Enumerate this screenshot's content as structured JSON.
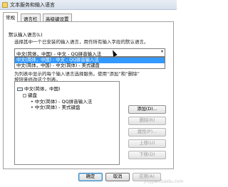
{
  "window": {
    "title": "文本服务和输入语言"
  },
  "tabs": [
    {
      "label": "常规",
      "active": true
    },
    {
      "label": "语言栏",
      "active": false
    },
    {
      "label": "高级键设置",
      "active": false
    }
  ],
  "default_language": {
    "heading": "默认输入语言(L)",
    "description": "选择其中一个已安装的输入语言，用作所有输入字段的默认语言。",
    "selected": "中文(简体，中国) - 中文 - QQ拼音输入法",
    "options": [
      "中文(简体，中国) - 中文 - QQ拼音输入法",
      "中文(简体，中国) - 中文(简体) - 美式键盘"
    ],
    "dropdown_arrow_icon": "▾"
  },
  "installed_services": {
    "description_line1": "为列表中显示的每个输入语言选择服务。使用“添加”和“删除”",
    "description_line2": "按钮来修改这个列表。",
    "tree": {
      "language": "中文(简体，中国)",
      "group": "键盘",
      "items": [
        "中文(简体) - QQ拼音输入法",
        "中文(简体) - 美式键盘"
      ]
    },
    "buttons": {
      "add": "添加(D)...",
      "remove": "删除(R)",
      "properties": "属性(P)...",
      "move_up": "上移(U)",
      "move_down": "下移(D)"
    }
  },
  "footer": {
    "ok": "确定",
    "cancel": "取消",
    "apply": "应用(A)"
  },
  "watermark": "jingyan.baidu.com"
}
